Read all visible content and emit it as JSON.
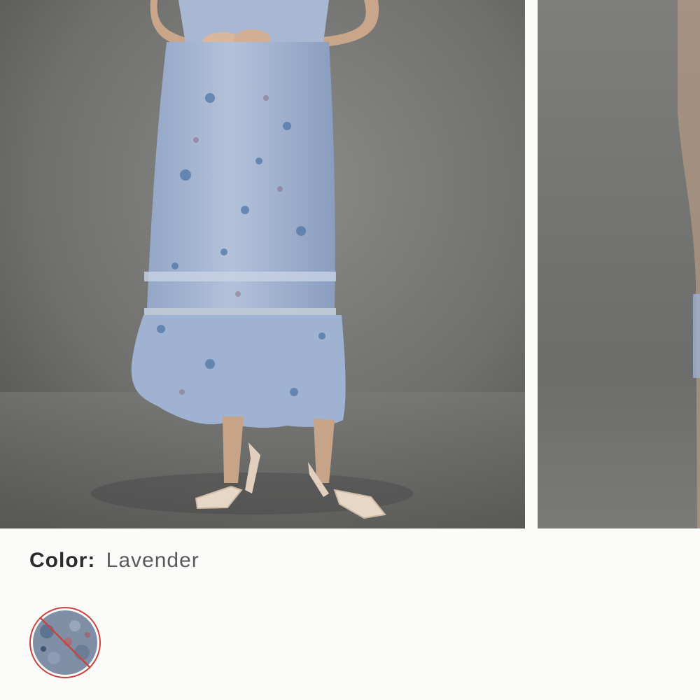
{
  "product": {
    "color_label": "Color:",
    "color_value": "Lavender"
  },
  "gallery": {
    "images": [
      {
        "name": "main-product-photo",
        "subject": "model-wearing-floral-tiered-maxi-dress"
      },
      {
        "name": "secondary-product-photo",
        "subject": "model-partial-view"
      }
    ]
  },
  "swatches": [
    {
      "name": "lavender-swatch",
      "selected": true,
      "available": false
    }
  ],
  "colors": {
    "page_background": "#fbfbf9",
    "photo_background": "#6e6f6d",
    "dress_blue": "#9eb1d0",
    "swatch_unavailable_ring": "#c9443f",
    "text_primary": "#2b2b2b"
  }
}
